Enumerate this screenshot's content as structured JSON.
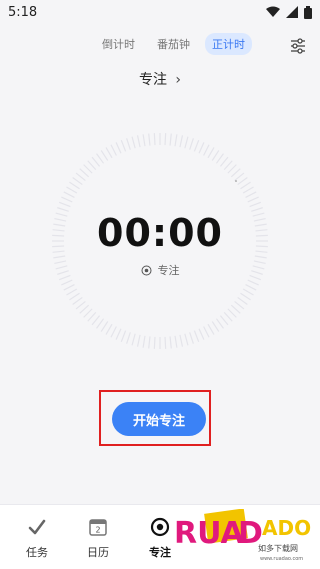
{
  "status_bar": {
    "time": "5:18"
  },
  "header": {
    "tabs": [
      {
        "label": "倒计时",
        "active": false
      },
      {
        "label": "番茄钟",
        "active": false
      },
      {
        "label": "正计时",
        "active": true
      }
    ]
  },
  "focus": {
    "title": "专注",
    "title_chevron": "›",
    "time": "00:00",
    "mode_label": "专注"
  },
  "actions": {
    "start_label": "开始专注"
  },
  "bottom_nav": {
    "items": [
      {
        "label": "任务",
        "icon": "check-icon"
      },
      {
        "label": "日历",
        "icon": "calendar-icon",
        "badge": "2"
      },
      {
        "label": "专注",
        "icon": "focus-icon"
      }
    ]
  },
  "colors": {
    "accent": "#3b82f6",
    "tab_active_bg": "#dbe8ff",
    "highlight_border": "#e02020"
  }
}
